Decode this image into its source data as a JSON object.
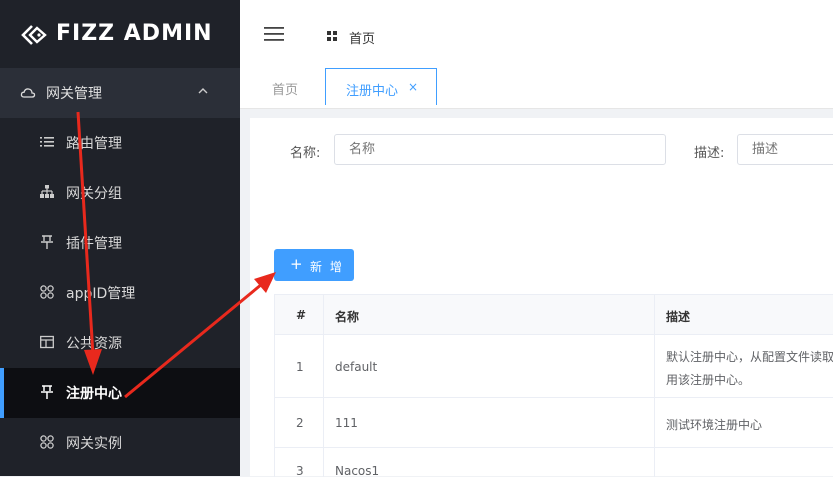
{
  "app": {
    "logo_text": "FIZZ ADMIN"
  },
  "sidebar": {
    "group": {
      "label": "网关管理",
      "icon": "cloud-icon"
    },
    "items": [
      {
        "label": "路由管理",
        "icon": "list-icon"
      },
      {
        "label": "网关分组",
        "icon": "hierarchy-icon"
      },
      {
        "label": "插件管理",
        "icon": "pin-icon"
      },
      {
        "label": "appID管理",
        "icon": "grid-icon"
      },
      {
        "label": "公共资源",
        "icon": "panel-icon"
      },
      {
        "label": "注册中心",
        "icon": "pin-icon",
        "active": true
      },
      {
        "label": "网关实例",
        "icon": "grid-icon"
      }
    ]
  },
  "header": {
    "breadcrumb": "首页"
  },
  "tabs": {
    "home": "首页",
    "active": "注册中心",
    "close": "×"
  },
  "filter": {
    "name_label": "名称:",
    "name_placeholder": "名称",
    "desc_label": "描述:",
    "desc_placeholder": "描述"
  },
  "toolbar": {
    "add_label": "新 增",
    "add_icon": "+"
  },
  "table": {
    "headers": [
      "#",
      "名称",
      "描述"
    ],
    "rows": [
      {
        "index": "1",
        "name": "default",
        "desc_line1": "默认注册中心，从配置文件读取",
        "desc_line2": "用该注册中心。"
      },
      {
        "index": "2",
        "name": "111",
        "desc_line1": "测试环境注册中心",
        "desc_line2": ""
      },
      {
        "index": "3",
        "name": "Nacos1",
        "desc_line1": "",
        "desc_line2": ""
      }
    ]
  },
  "colors": {
    "accent": "#409eff",
    "sidebar_bg": "#1f2229",
    "annotation_arrow": "#e8291d"
  }
}
